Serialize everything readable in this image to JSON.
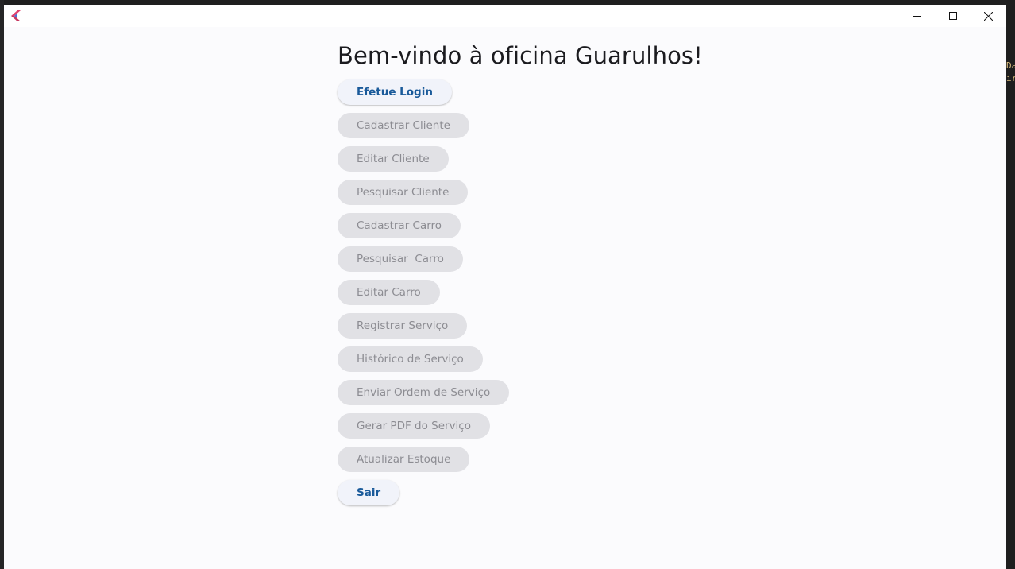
{
  "window": {
    "controls": {
      "minimize_icon": "minimize-icon",
      "maximize_icon": "maximize-icon",
      "close_icon": "close-icon"
    }
  },
  "background_editor": {
    "right_fragments": [
      "Da",
      "ir"
    ]
  },
  "main": {
    "title": "Bem-vindo à oficina Guarulhos!",
    "buttons": [
      {
        "label": "Efetue Login",
        "enabled": true
      },
      {
        "label": "Cadastrar Cliente",
        "enabled": false
      },
      {
        "label": "Editar Cliente",
        "enabled": false
      },
      {
        "label": "Pesquisar Cliente",
        "enabled": false
      },
      {
        "label": "Cadastrar Carro",
        "enabled": false
      },
      {
        "label": "Pesquisar  Carro",
        "enabled": false
      },
      {
        "label": "Editar Carro",
        "enabled": false
      },
      {
        "label": "Registrar Serviço",
        "enabled": false
      },
      {
        "label": "Histórico de Serviço",
        "enabled": false
      },
      {
        "label": "Enviar Ordem de Serviço",
        "enabled": false
      },
      {
        "label": "Gerar PDF do Serviço",
        "enabled": false
      },
      {
        "label": "Atualizar Estoque",
        "enabled": false
      },
      {
        "label": "Sair",
        "enabled": true
      }
    ]
  },
  "colors": {
    "enabled_text": "#1a5a9a",
    "disabled_text": "#8c8c92",
    "window_bg": "#fbfbfd"
  }
}
